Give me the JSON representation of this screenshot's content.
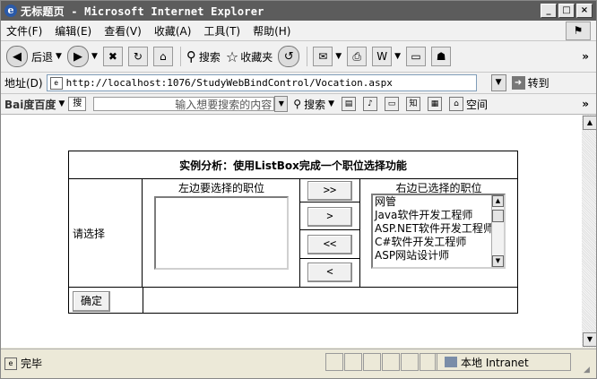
{
  "window": {
    "title": "无标题页 - Microsoft Internet Explorer",
    "controls": [
      "_",
      "□",
      "×"
    ]
  },
  "menu": [
    "文件(F)",
    "编辑(E)",
    "查看(V)",
    "收藏(A)",
    "工具(T)",
    "帮助(H)"
  ],
  "toolbar": {
    "back": "后退",
    "search": "搜索",
    "favorites": "收藏夹",
    "overflow": "»"
  },
  "address": {
    "label": "地址(D)",
    "url": "http://localhost:1076/StudyWebBindControl/Vocation.aspx",
    "go": "转到"
  },
  "baidu": {
    "logo": "Bai度百度",
    "placeholder": "输入想要搜索的内容",
    "search": "搜索",
    "space": "空间",
    "overflow": "»"
  },
  "page": {
    "heading": "实例分析：使用ListBox完成一个职位选择功能",
    "prompt": "请选择",
    "left_caption": "左边要选择的职位",
    "right_caption": "右边已选择的职位",
    "buttons": {
      "move_all_right": ">>",
      "move_right": ">",
      "move_all_left": "<<",
      "move_left": "<"
    },
    "left_items": [],
    "right_items": [
      "网管",
      "Java软件开发工程师",
      "ASP.NET软件开发工程师",
      "C#软件开发工程师",
      "ASP网站设计师"
    ],
    "confirm": "确定"
  },
  "status": {
    "text": "完毕",
    "zone": "本地 Intranet"
  }
}
